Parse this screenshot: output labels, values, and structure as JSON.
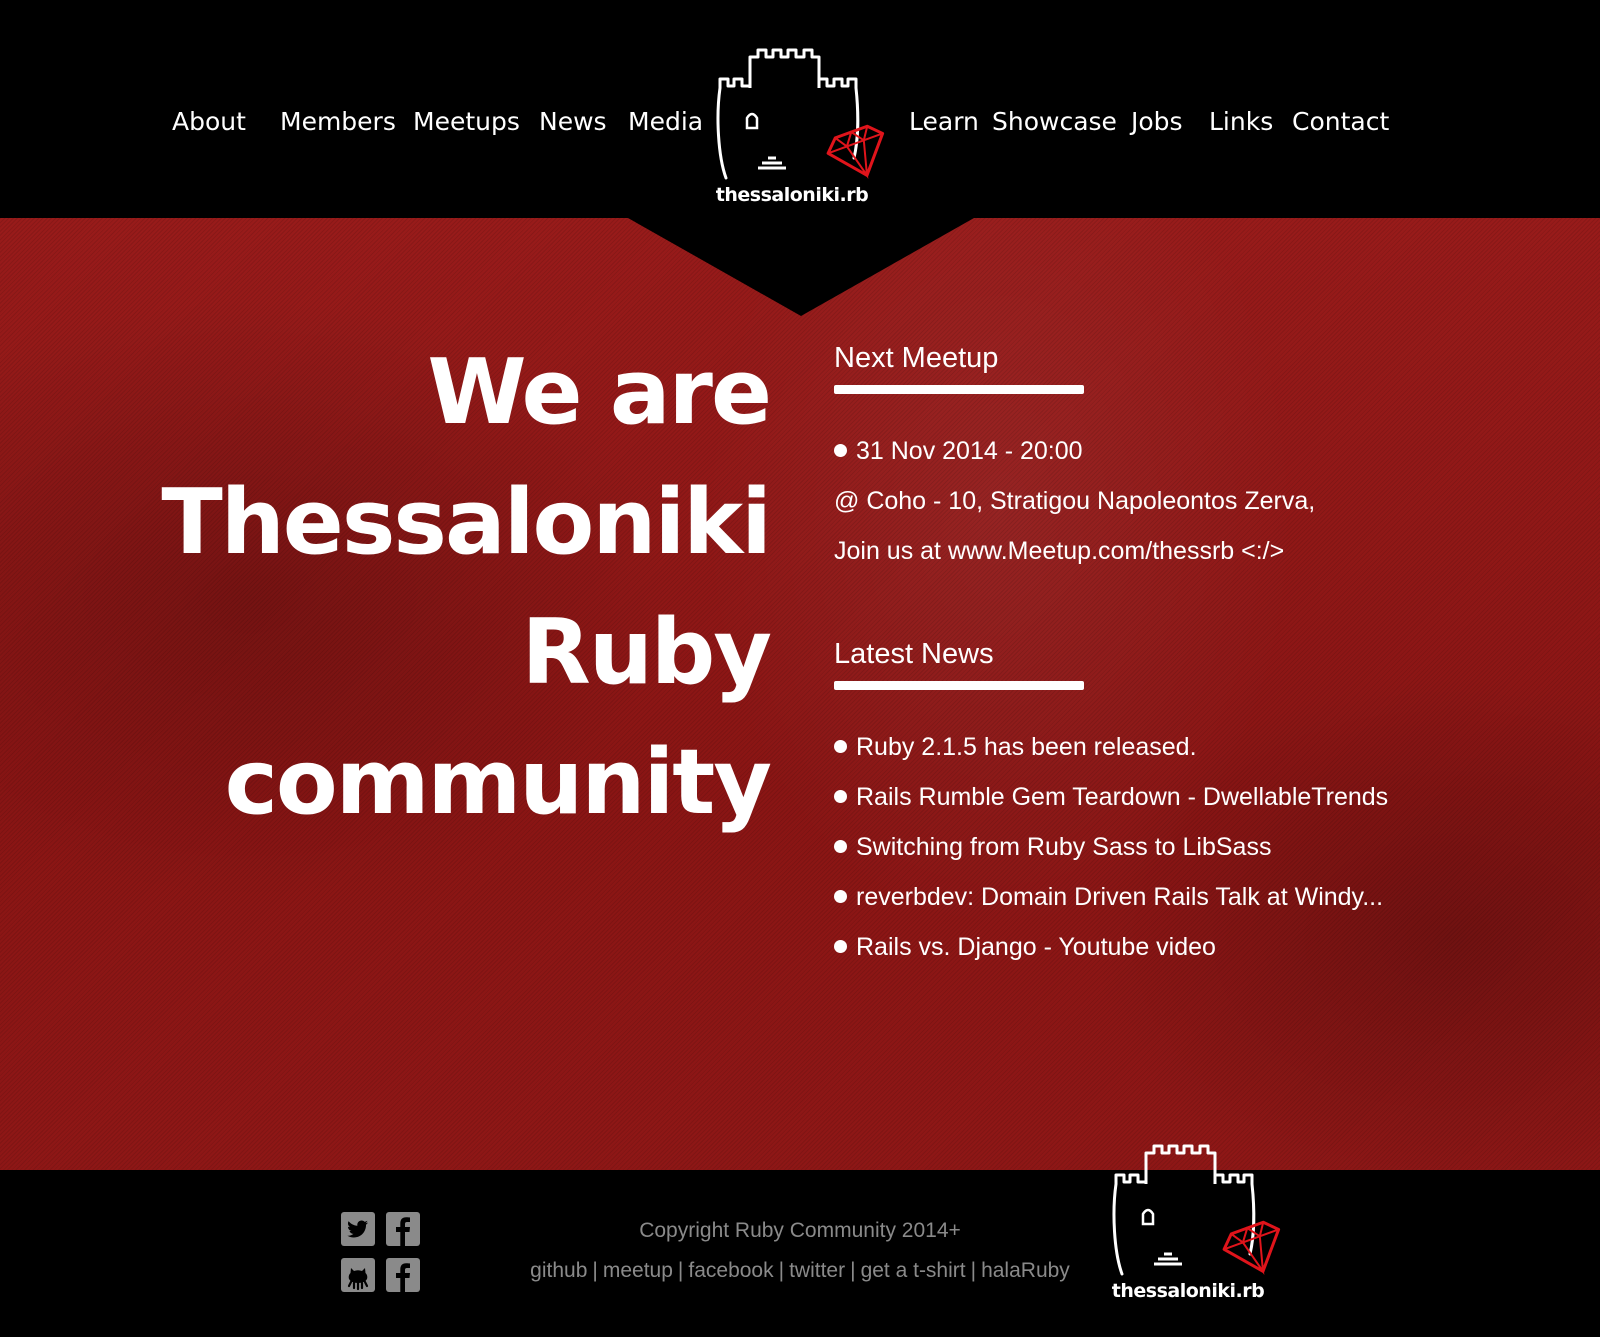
{
  "nav": {
    "left": [
      "About",
      "Members",
      "Meetups",
      "News",
      "Media"
    ],
    "right": [
      "Learn",
      "Showcase",
      "Jobs",
      "Links",
      "Contact"
    ]
  },
  "logo": {
    "text": "thessaloniki.rb",
    "icon": "castle-tower-with-ruby-gem"
  },
  "hero": {
    "title_lines": [
      "We are",
      "Thessaloniki",
      "Ruby",
      "community"
    ]
  },
  "next_meetup": {
    "heading": "Next Meetup",
    "lines": [
      "31 Nov 2014 - 20:00",
      "@ Coho -  10, Stratigou Napoleontos Zerva,",
      "Join us at www.Meetup.com/thessrb <:/>"
    ]
  },
  "latest_news": {
    "heading": "Latest News",
    "items": [
      "Ruby 2.1.5 has been released.",
      "Rails Rumble Gem Teardown - DwellableTrends",
      "Switching from Ruby Sass to LibSass",
      "reverbdev: Domain Driven Rails Talk at Windy...",
      "Rails vs. Django - Youtube video"
    ]
  },
  "footer": {
    "copyright": "Copyright Ruby Community 2014+",
    "links": [
      "github",
      "meetup",
      "facebook",
      "twitter",
      "get a t-shirt",
      "halaRuby"
    ],
    "separator": "|",
    "social_icons": [
      "twitter-icon",
      "facebook-icon",
      "github-icon",
      "facebook-icon"
    ]
  },
  "colors": {
    "hero_red": "#8e1716",
    "ruby_red": "#e0141b",
    "footer_text": "#8a8a8a",
    "header_bg": "#000000"
  }
}
